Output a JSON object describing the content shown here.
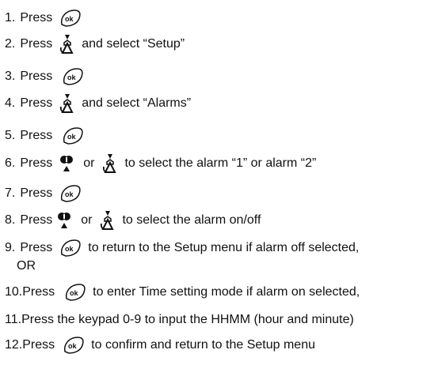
{
  "steps": [
    {
      "num": "1.",
      "parts": [
        "Press"
      ],
      "icons": [
        "ok-icon"
      ],
      "after": [
        ""
      ]
    },
    {
      "num": "2.",
      "parts": [
        "Press"
      ],
      "icons": [
        "down-phone-icon"
      ],
      "after": [
        "and select “Setup”"
      ]
    },
    {
      "num": "3.",
      "parts": [
        "Press"
      ],
      "icons": [
        "ok-icon"
      ],
      "after": [
        ""
      ]
    },
    {
      "num": "4.",
      "parts": [
        "Press"
      ],
      "icons": [
        "down-phone-icon"
      ],
      "after": [
        "and select “Alarms”"
      ]
    },
    {
      "num": "5.",
      "parts": [
        "Press"
      ],
      "icons": [
        "ok-icon"
      ],
      "after": [
        ""
      ]
    },
    {
      "num": "6.",
      "parts": [
        "Press"
      ],
      "icons": [
        "up-icon",
        "down-phone-icon"
      ],
      "middle": "or",
      "after": [
        "to select the alarm “1” or alarm “2”"
      ]
    },
    {
      "num": "7.",
      "parts": [
        "Press"
      ],
      "icons": [
        "ok-icon"
      ],
      "after": [
        ""
      ]
    },
    {
      "num": "8.",
      "parts": [
        "Press"
      ],
      "icons": [
        "up-icon",
        "down-phone-icon"
      ],
      "middle": "or",
      "after": [
        "to select the alarm on/off"
      ]
    },
    {
      "num": "9.",
      "parts": [
        "Press"
      ],
      "icons": [
        "ok-icon"
      ],
      "after": [
        "to return to the Setup menu if alarm off selected,"
      ],
      "continuation": "OR"
    },
    {
      "num": "10.",
      "parts": [
        "Press"
      ],
      "icons": [
        "ok-icon"
      ],
      "after": [
        "to enter Time setting mode if alarm on selected,"
      ]
    },
    {
      "num": "11.",
      "parts": [
        "Press the keypad 0-9 to input the HHMM (hour and minute)"
      ],
      "icons": [],
      "after": []
    },
    {
      "num": "12.",
      "parts": [
        "Press"
      ],
      "icons": [
        "ok-icon"
      ],
      "after": [
        "to confirm and return to the Setup menu"
      ]
    }
  ],
  "ok_icon_text": "ok"
}
